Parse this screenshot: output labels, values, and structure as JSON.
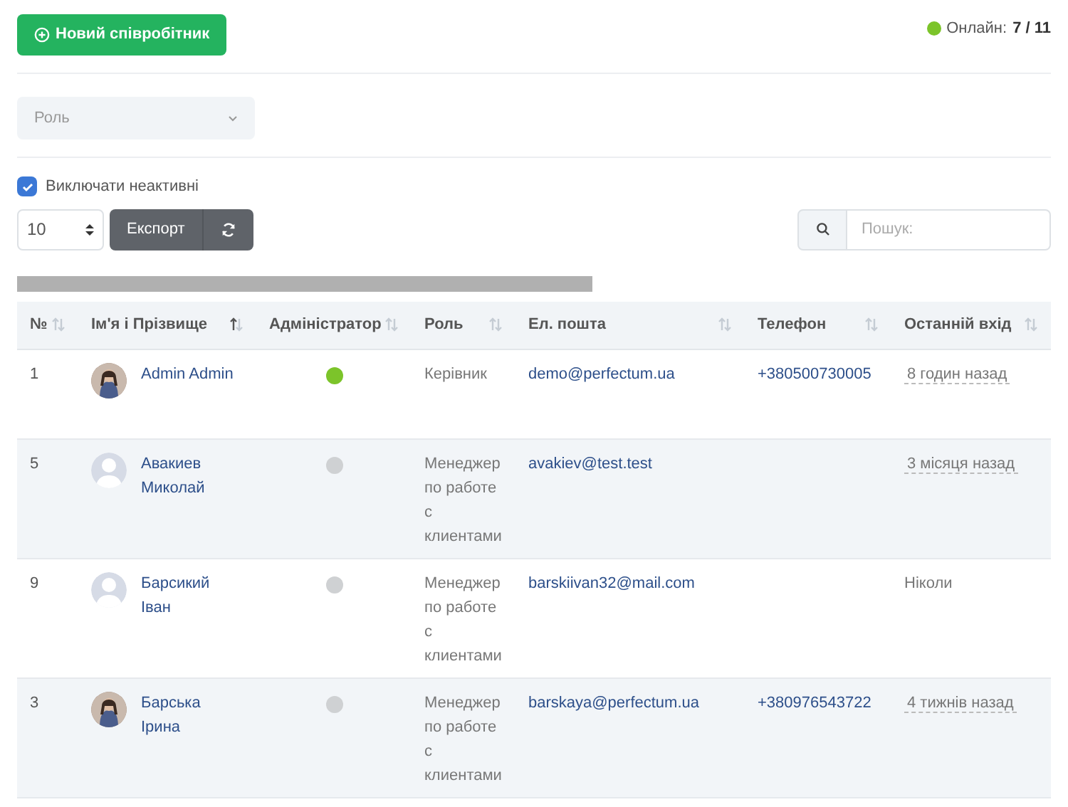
{
  "new_button": {
    "label": "Новий співробітник"
  },
  "online": {
    "label": "Онлайн:",
    "count": "7 / 11"
  },
  "role_filter": {
    "placeholder": "Роль"
  },
  "exclude_inactive": {
    "label": "Виключати неактивні",
    "checked": true
  },
  "page_size": {
    "value": "10"
  },
  "export_button": {
    "label": "Експорт"
  },
  "search": {
    "placeholder": "Пошук:"
  },
  "table": {
    "columns": [
      {
        "label": "№",
        "sorted": false
      },
      {
        "label": "Ім'я і Прізвище",
        "sorted": true
      },
      {
        "label": "Адміністратор",
        "sorted": false
      },
      {
        "label": "Роль",
        "sorted": false
      },
      {
        "label": "Ел. пошта",
        "sorted": false
      },
      {
        "label": "Телефон",
        "sorted": false
      },
      {
        "label": "Останній вхід",
        "sorted": false
      }
    ],
    "rows": [
      {
        "number": "1",
        "name": "Admin Admin",
        "photo": true,
        "admin": true,
        "role": "Керівник",
        "email": "demo@perfectum.ua",
        "phone": "+380500730005",
        "last_login": "8 годин назад",
        "dated": true
      },
      {
        "number": "5",
        "name": "Авакиев Миколай",
        "photo": false,
        "admin": false,
        "role": "Менеджер по работе с клиентами",
        "email": "avakiev@test.test",
        "last_login": "3 місяця назад",
        "dated": true
      },
      {
        "number": "9",
        "name": "Барсикий Іван",
        "photo": false,
        "admin": false,
        "role": "Менеджер по работе с клиентами",
        "email": "barskiivan32@mail.com",
        "last_login": "Ніколи",
        "dated": false
      },
      {
        "number": "3",
        "name": "Барська Ірина",
        "photo": true,
        "admin": false,
        "role": "Менеджер по работе с клиентами",
        "email": "barskaya@perfectum.ua",
        "phone": "+380976543722",
        "last_login": "4 тижнів назад",
        "dated": true
      }
    ]
  }
}
